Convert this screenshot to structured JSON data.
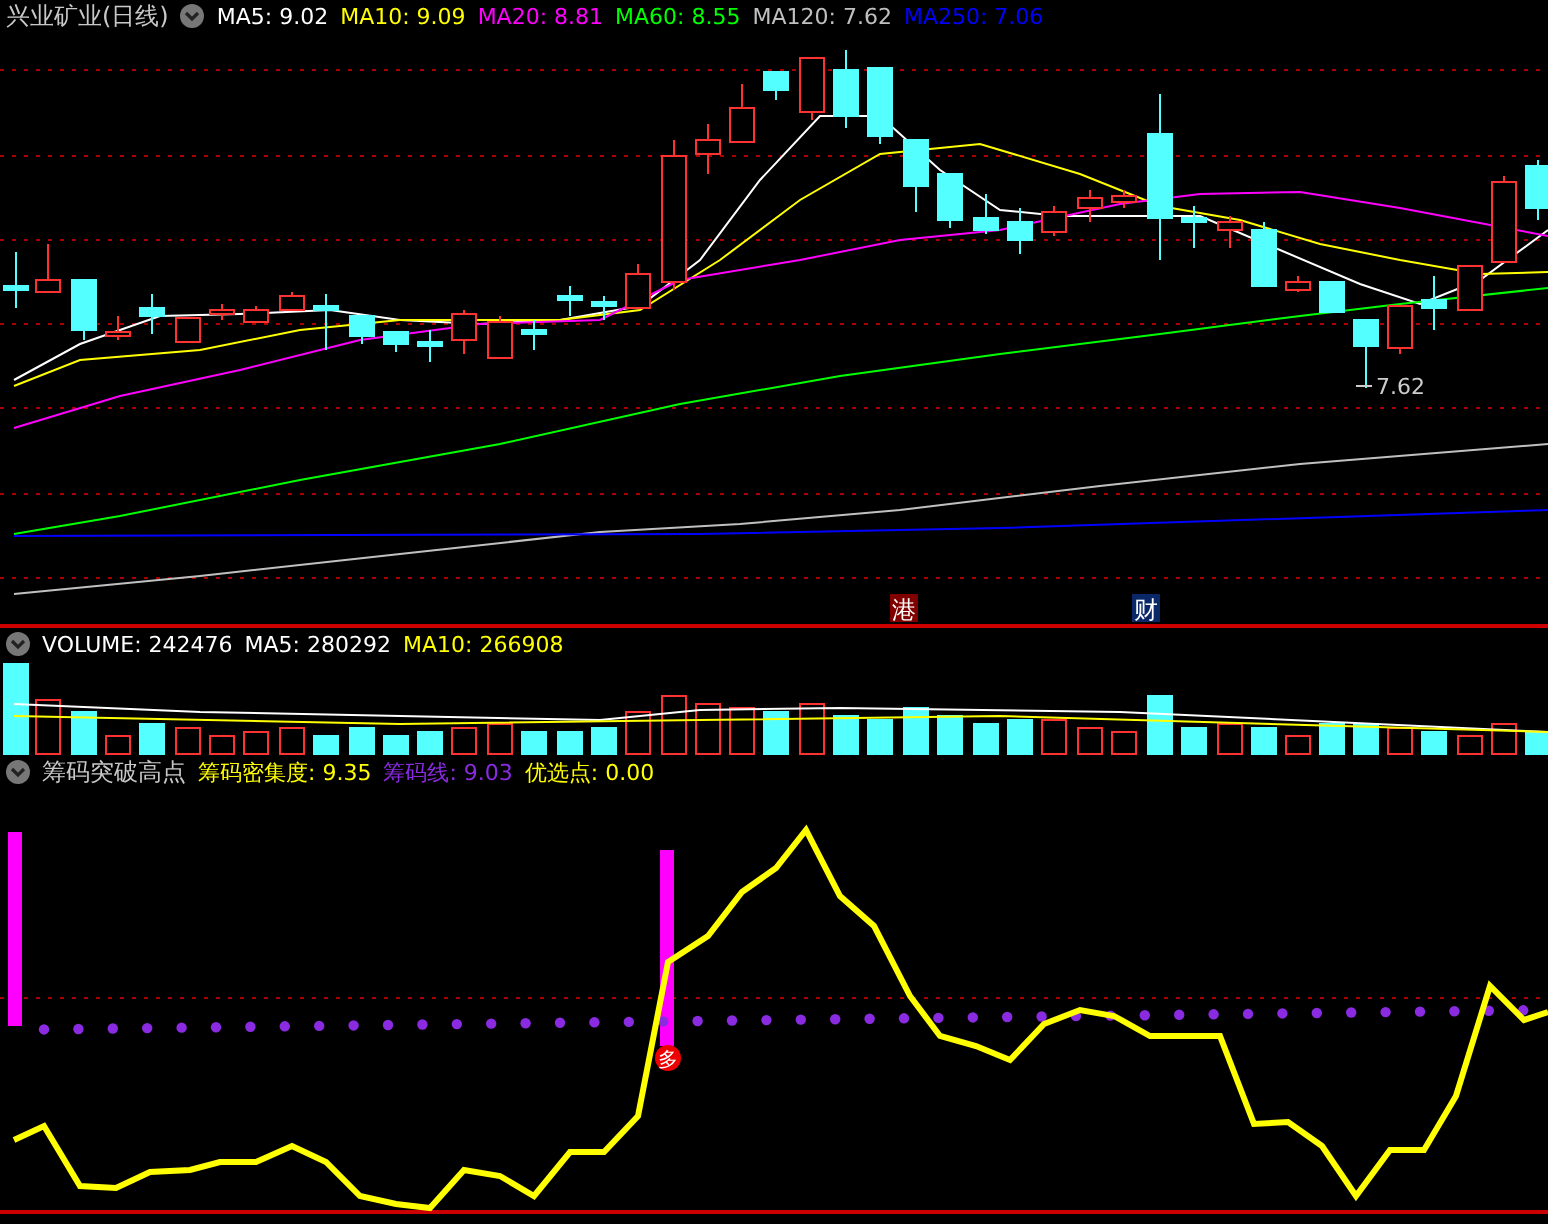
{
  "price_panel": {
    "title": "兴业矿业(日线)",
    "indicators": [
      {
        "label": "MA5: 9.02",
        "color": "#ffffff"
      },
      {
        "label": "MA10: 9.09",
        "color": "#ffff00"
      },
      {
        "label": "MA20: 8.81",
        "color": "#ff00ff"
      },
      {
        "label": "MA60: 8.55",
        "color": "#00ff00"
      },
      {
        "label": "MA120: 7.62",
        "color": "#c0c0c0"
      },
      {
        "label": "MA250: 7.06",
        "color": "#0000ff"
      }
    ],
    "low_marker": "7.62",
    "event_tags": [
      {
        "label": "港",
        "color": "#800000"
      },
      {
        "label": "财",
        "color": "#0a2868"
      }
    ]
  },
  "volume_panel": {
    "indicators": [
      {
        "label": "VOLUME: 242476",
        "color": "#ffffff"
      },
      {
        "label": "MA5: 280292",
        "color": "#ffffff"
      },
      {
        "label": "MA10: 266908",
        "color": "#ffff00"
      }
    ]
  },
  "indicator_panel": {
    "title": "筹码突破高点",
    "indicators": [
      {
        "label": "筹码密集度: 9.35",
        "color": "#ffff00"
      },
      {
        "label": "筹码线: 9.03",
        "color": "#8a2be2"
      },
      {
        "label": "优选点: 0.00",
        "color": "#ffff00"
      }
    ],
    "signal_badge": "多"
  }
}
